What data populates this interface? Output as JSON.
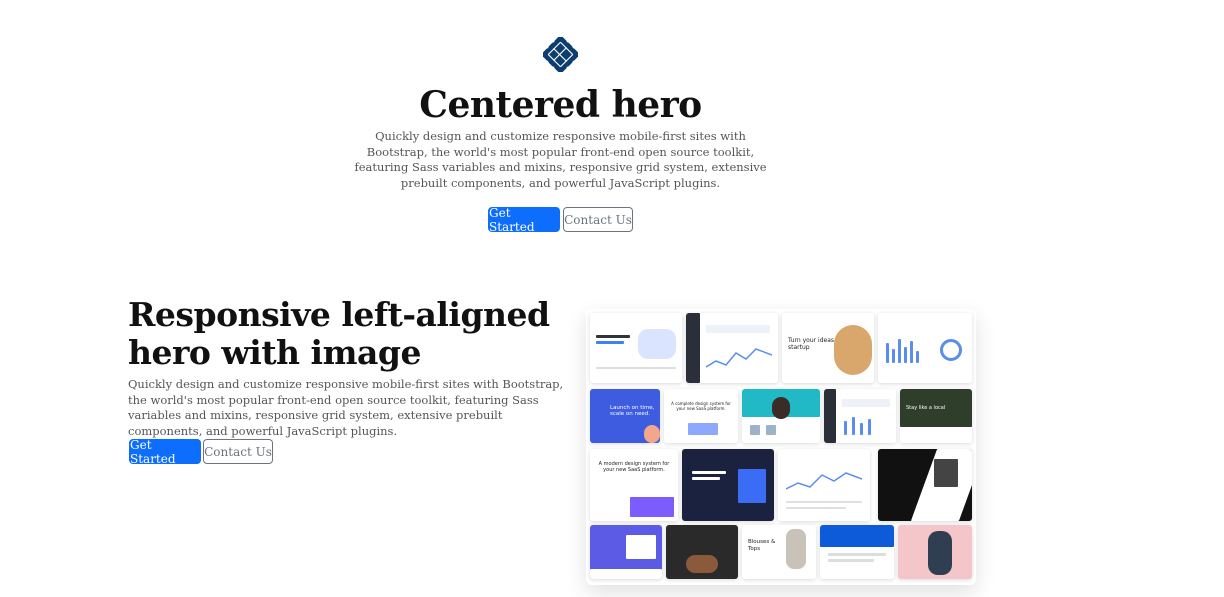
{
  "hero": {
    "title": "Centered hero",
    "description": "Quickly design and customize responsive mobile-first sites with Bootstrap, the world's most popular front-end open source toolkit, featuring Sass variables and mixins, responsive grid system, extensive prebuilt components, and powerful JavaScript plugins.",
    "primary_button": "Get Started",
    "secondary_button": "Contact Us"
  },
  "left_hero": {
    "title": "Responsive left-aligned hero with image",
    "description": "Quickly design and customize responsive mobile-first sites with Bootstrap, the world's most popular front-end open source toolkit, featuring Sass variables and mixins, responsive grid system, extensive prebuilt components, and powerful JavaScript plugins.",
    "primary_button": "Get Started",
    "secondary_button": "Contact Us"
  },
  "colors": {
    "primary": "#0d6efd",
    "logo": "#0b3d6e",
    "outline": "#6c757d"
  },
  "icons": {
    "logo": "bootstrap-knot-logo-icon"
  },
  "collage": {
    "tiles": [
      {
        "label": "Turn your ideas into a startup"
      },
      {
        "label": "Launch on time, scale on need."
      },
      {
        "label": "A complete design system for your new SaaS platform."
      },
      {
        "label": "Stay like a local"
      },
      {
        "label": "A modern design system for your new SaaS platform."
      },
      {
        "label": "Blouses & Tops"
      }
    ]
  }
}
